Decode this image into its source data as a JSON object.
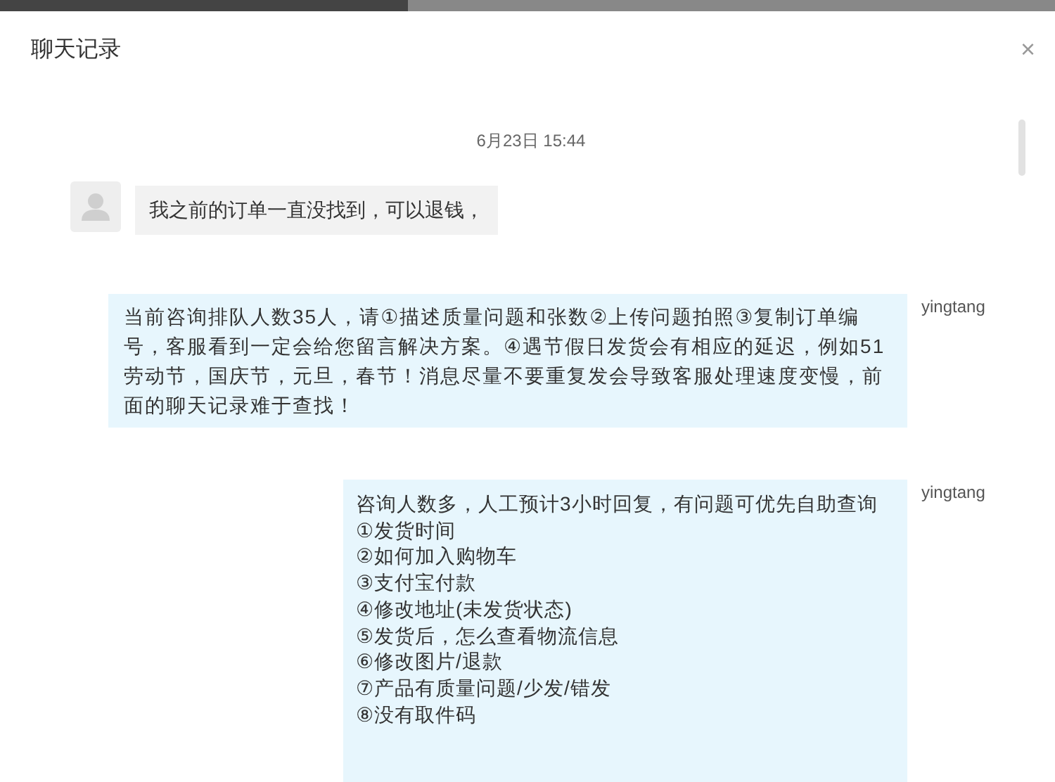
{
  "dialog": {
    "title": "聊天记录",
    "close": "×"
  },
  "timestamp": "6月23日 15:44",
  "messages": [
    {
      "kind": "customer",
      "lines": [
        "我之前的订单一直没找到，可以退钱，"
      ]
    },
    {
      "kind": "agent",
      "sender": "yingtang",
      "lines": [
        "当前咨询排队人数35人，请①描述质量问题和张数②上传问题拍照③复制订单编号，客服看到一定会给您留言解决方案。④遇节假日发货会有相应的延迟，例如51劳动节，国庆节，元旦，春节！消息尽量不要重复发会导致客服处理速度变慢，前面的聊天记录难于查找！"
      ]
    },
    {
      "kind": "agent",
      "sender": "yingtang",
      "lines": [
        "咨询人数多，人工预计3小时回复，有问题可优先自助查询",
        "①发货时间",
        "②如何加入购物车",
        "③支付宝付款",
        "④修改地址(未发货状态)",
        "⑤发货后，怎么查看物流信息",
        "⑥修改图片/退款",
        "⑦产品有质量问题/少发/错发",
        "⑧没有取件码"
      ]
    }
  ]
}
